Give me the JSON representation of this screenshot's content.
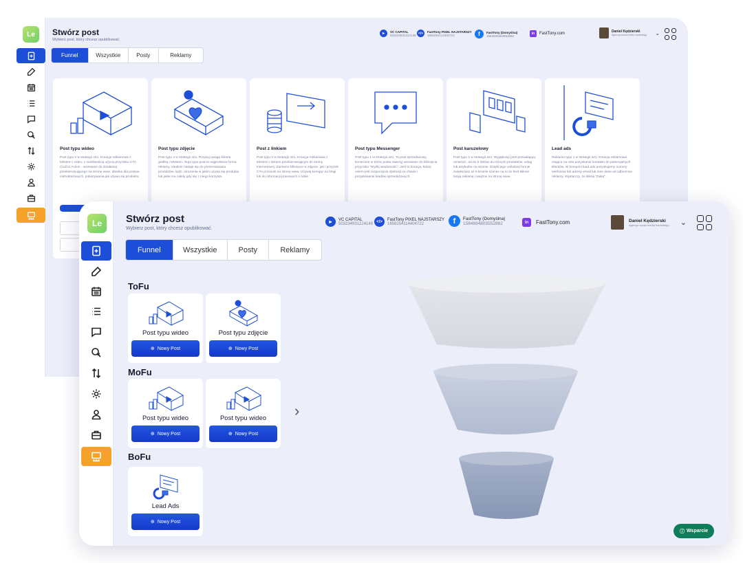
{
  "app_logo": "Le",
  "back": {
    "title": "Stwórz post",
    "subtitle": "Wybierz post, który chcesz opublikować.",
    "accounts": [
      {
        "name": "VC CAPITAL",
        "id": "503234931224148",
        "icon": "megaphone-icon",
        "color": "#1d4ed8"
      },
      {
        "name": "FastTony PIXEL NAJSTARSZY",
        "id": "1658254114404722",
        "icon": "code-icon",
        "color": "#1d4ed8"
      },
      {
        "name": "FastTony (Domyślna)",
        "id": "1584694803552882",
        "icon": "facebook-icon",
        "color": "#1877f2"
      },
      {
        "name": "FastTony.com",
        "id": "",
        "icon": "linkedin-icon",
        "color": "#7c3aed"
      }
    ],
    "user": {
      "name": "Daniel Kędzierski",
      "role": "Agencja sociai media marketingu"
    },
    "tabs": [
      "Funnel",
      "Wszystkie",
      "Posty",
      "Reklamy"
    ],
    "cards": [
      {
        "title": "Post typu wideo",
        "desc": "Post typu 2 w strategii 421. Kreacja reklamowa z tekstem i video, z możliwością użycia przycisku CTA (Call to Action - wezwanie do działania) przekierowującego na stronę www. Idealna dla postów instruktażowych, pokazywania jak używa się produktu."
      },
      {
        "title": "Post typu zdjęcie",
        "desc": "Post typu 4 w strategii 421. Przykuj uwagę klienta grafiką i tekstem. Tego typu post to najprostsza forma reklamy, idealnie nadaje się do prezentowania produktów, ludzi, otoczenia w jakim używa się produktu lub jakie ma zalety gdy się z niego korzysta."
      },
      {
        "title": "Post z linkiem",
        "desc": "Post typu 2 w strategii 421. Kreacja reklamowa z tekstem i linkiem przekierowującym do strony internetowej. Zarówno kliknięcie w zdjęcie, jak i przycisk CTA przenosi na stronę www. Używaj kierując na blogi lub do informacji prasowych o tobie."
      },
      {
        "title": "Post typu Messenger",
        "desc": "Post typu 1 w strategii 421. To post sprzedażowy, konieczne w treści postu zawrzyj wezwanie do kliknięcia przycisku \"Wyślij wiadomość\". Jest to kreacja, której celem jest rozpoczęcie dyskusji na chacie i pozyskiwanie leadów sprzedażowych."
      },
      {
        "title": "Post karuzelowy",
        "desc": "Post typu 1 w strategii 421. Wyjątkowy post pozwalający umieścić, od do 5 linków do różnych produktów, usług lub artykułów na stronie. Dzięki jego unikalnej formie zwiększasz aż 5 krotnie szanse na to że ktoś kliknie twoją reklamę i wejdzie na stronę www."
      },
      {
        "title": "Lead ads",
        "desc": "Reklama typu 1 w strategii 421. Kreacja reklamowa mająca na celu pozyskanie kontaktu do potencjalnych klientów. W komponi lead ads pozyskujemy numery telefonów lub adresy email lub inne dane od odbiorców reklamy. Wystarczy, że kliknę \"Dalej\"."
      }
    ]
  },
  "front": {
    "title": "Stwórz post",
    "subtitle": "Wybierz post, który chcesz opublikować.",
    "accounts": [
      {
        "name": "VC CAPITAL",
        "id": "503234931224148",
        "icon": "megaphone-icon",
        "color": "#1d4ed8"
      },
      {
        "name": "FastTony PIXEL NAJSTARSZY",
        "id": "1658254114404722",
        "icon": "code-icon",
        "color": "#1d4ed8"
      },
      {
        "name": "FastTony (Domyślna)",
        "id": "1584694803552882",
        "icon": "facebook-icon",
        "color": "#1877f2"
      },
      {
        "name": "FastTony.com",
        "id": "",
        "icon": "linkedin-icon",
        "color": "#7c3aed"
      }
    ],
    "user": {
      "name": "Daniel Kędzierski",
      "role": "Agencja social media marketingu"
    },
    "tabs": [
      "Funnel",
      "Wszystkie",
      "Posty",
      "Reklamy"
    ],
    "sections": [
      {
        "label": "ToFu",
        "cards": [
          {
            "label": "Post typu wideo",
            "button": "Nowy Post",
            "icon": "video-post-icon"
          },
          {
            "label": "Post typu zdjęcie",
            "button": "Nowy Post",
            "icon": "photo-post-icon"
          }
        ]
      },
      {
        "label": "MoFu",
        "cards": [
          {
            "label": "Post typu wideo",
            "button": "Nowy Post",
            "icon": "video-post-icon"
          },
          {
            "label": "Post typu wideo",
            "button": "Nowy Post",
            "icon": "video-post-icon"
          }
        ]
      },
      {
        "label": "BoFu",
        "cards": [
          {
            "label": "Lead Ads",
            "button": "Nowy Post",
            "icon": "lead-ads-icon"
          }
        ]
      }
    ],
    "support_label": "Wsparcie"
  },
  "colors": {
    "accent": "#1d4ed8",
    "active_sidebar_orange": "#f7a12d",
    "support": "#0e7e5a",
    "funnel_top": "#e2e3e9",
    "funnel_mid": "#b8c1d6",
    "funnel_bottom": "#8e9cb9"
  }
}
